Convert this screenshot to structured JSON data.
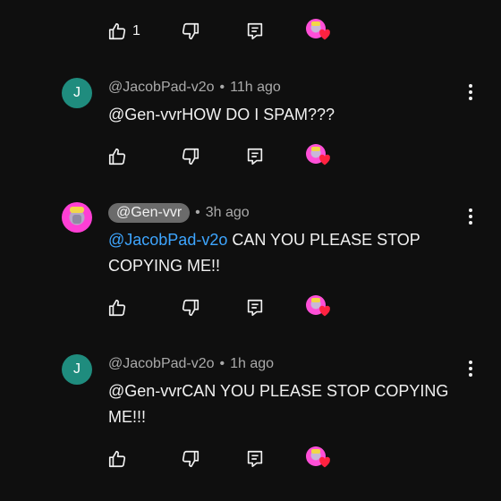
{
  "colors": {
    "background": "#0f0f0f",
    "text": "#f1f1f1",
    "muted": "#aaaaaa",
    "mention": "#3ea6ff",
    "avatar_letter_bg": "#1f8c7e",
    "heart": "#ff2240"
  },
  "top_actions": {
    "like_count": "1"
  },
  "comments": [
    {
      "author": "@JacobPad-v2o",
      "avatar_letter": "J",
      "separator": "•",
      "time": "11h ago",
      "text": "@Gen-vvrHOW DO I SPAM???"
    },
    {
      "author": "@Gen-vvr",
      "separator": "•",
      "time": "3h ago",
      "mention": "@JacobPad-v2o",
      "text": " CAN YOU PLEASE STOP COPYING ME!!"
    },
    {
      "author": "@JacobPad-v2o",
      "avatar_letter": "J",
      "separator": "•",
      "time": "1h ago",
      "text": "@Gen-vvrCAN YOU PLEASE STOP COPYING ME!!!"
    }
  ],
  "icons": {
    "like": "thumbs-up-icon",
    "dislike": "thumbs-down-icon",
    "reply": "reply-icon",
    "more": "more-vertical-icon",
    "creator_heart": "creator-heart-icon"
  }
}
